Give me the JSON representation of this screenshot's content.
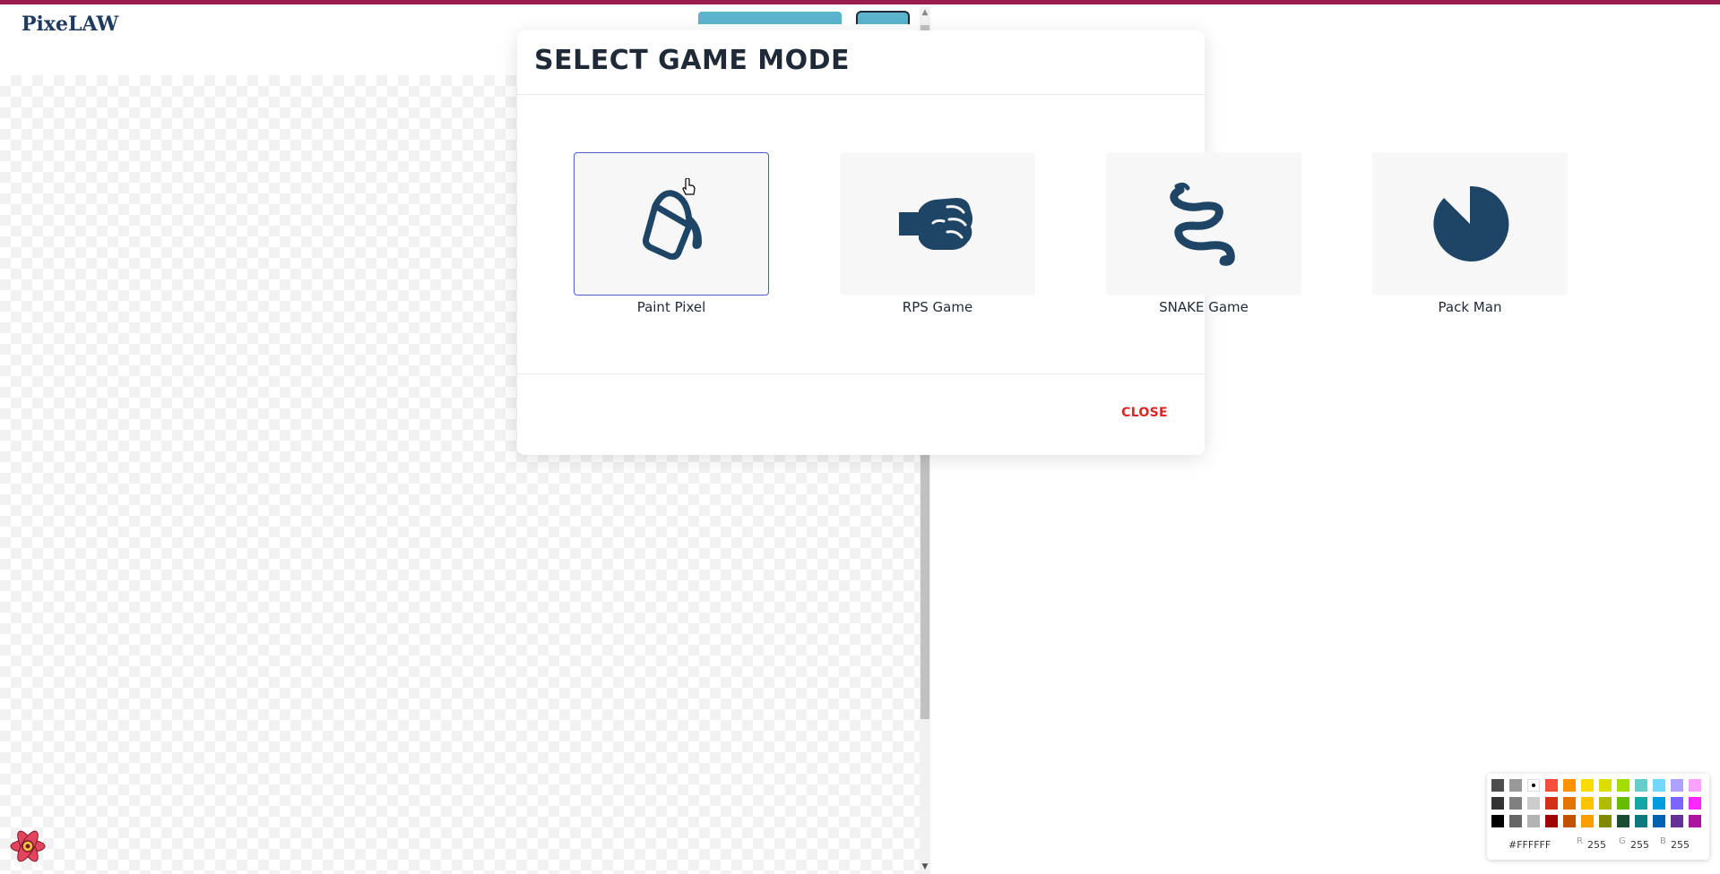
{
  "app": {
    "logo_text": "PixeLAW"
  },
  "modal": {
    "title": "SELECT GAME MODE",
    "close_label": "CLOSE",
    "games": [
      {
        "label": "Paint Pixel",
        "icon": "paint-bucket-icon",
        "selected": true
      },
      {
        "label": "RPS Game",
        "icon": "fist-icon",
        "selected": false
      },
      {
        "label": "SNAKE Game",
        "icon": "snake-icon",
        "selected": false
      },
      {
        "label": "Pack Man",
        "icon": "pacman-icon",
        "selected": false
      }
    ]
  },
  "palette": {
    "hex": "#FFFFFF",
    "r_label": "R",
    "r": "255",
    "g_label": "G",
    "g": "255",
    "b_label": "B",
    "b": "255",
    "colors": [
      [
        "#4d4d4d",
        "#999999",
        "#ffffff",
        "#f44e3b",
        "#fe9200",
        "#fcdc00",
        "#dbdf00",
        "#a4dd00",
        "#68ccca",
        "#73d8ff",
        "#aea1ff",
        "#fda1ff"
      ],
      [
        "#333333",
        "#808080",
        "#cccccc",
        "#d33115",
        "#e27300",
        "#fcc400",
        "#b0bc00",
        "#68bc00",
        "#16a5a5",
        "#009ce0",
        "#7b64ff",
        "#fa28ff"
      ],
      [
        "#000000",
        "#666666",
        "#b3b3b3",
        "#9f0500",
        "#c45100",
        "#fb9e00",
        "#808900",
        "#194d33",
        "#0c797d",
        "#0062b1",
        "#653294",
        "#ab149e"
      ]
    ]
  },
  "colors": {
    "accent_top": "#9b1c4f",
    "icon": "#1e4566",
    "close": "#dc2626",
    "selected_border": "#4f5bd5"
  }
}
